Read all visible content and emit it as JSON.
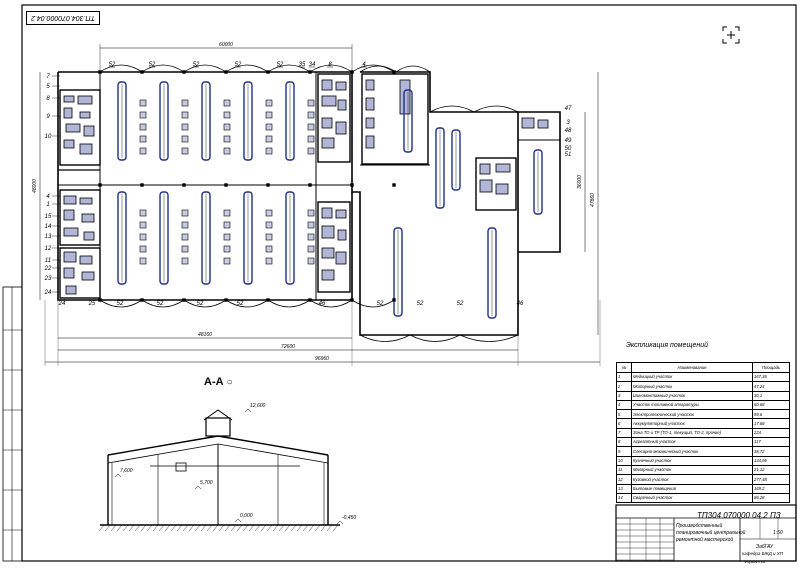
{
  "doc_code_top": "ТП.304.070000.04.2",
  "doc_code_title": "ТП304 070000 04.2 ПЗ",
  "section": {
    "name": "А-А"
  },
  "explikation_title": "Экспликация помещений",
  "table": {
    "headers": [
      "№",
      "Наименование",
      "Площадь"
    ],
    "rows": [
      [
        "1",
        "Медницкий участок",
        "167,36"
      ],
      [
        "2",
        "Моторный участок",
        "47,24"
      ],
      [
        "3",
        "Шиномонтажный участок",
        "30,1"
      ],
      [
        "4",
        "Участок топливной аппаратуры",
        "60,68"
      ],
      [
        "5",
        "Электротехнический участок",
        "99,6"
      ],
      [
        "6",
        "Аккумуляторный участок",
        "17,68"
      ],
      [
        "7",
        "Зона ТО и ТР (ТО-1, текущий, ТО-2, прочие)",
        "224"
      ],
      [
        "8",
        "Агрегатный участок",
        "117"
      ],
      [
        "9",
        "Слесарно-механический участок",
        "38,72"
      ],
      [
        "10",
        "Кузнечный участок",
        "144,96"
      ],
      [
        "11",
        "Малярный участок",
        "21,12"
      ],
      [
        "12",
        "Кузовной участок",
        "277,48"
      ],
      [
        "13",
        "Бытовые помещения",
        "169,2"
      ],
      [
        "14",
        "Сварочный участок",
        "86,28"
      ]
    ]
  },
  "title_block": {
    "description_line1": "Производственный",
    "description_line2": "планировочный центральной",
    "description_line3": "ремонтной мастерской",
    "scale": "1:50",
    "department_line1": "ЗабГАУ",
    "department_line2": "кафедра БЖД и ХП",
    "sheet_label": "Формат А1"
  },
  "dims": {
    "top_overall": "60000",
    "bottom_1": "48160",
    "bottom_2": "72600",
    "bottom_3": "96960",
    "left_height": "48000",
    "right_height_1": "36000",
    "right_height_2": "47860",
    "sec_top": "12,600",
    "sec_left": "7,600",
    "sec_mid": "5,700",
    "sec_ground": "0,000",
    "sec_right": "-0,450"
  },
  "plan_top_labels": [
    "52",
    "52",
    "52",
    "52",
    "52",
    "35",
    "34",
    "8",
    "4"
  ],
  "plan_bottom_labels": [
    "24",
    "25",
    "52",
    "52",
    "52",
    "52",
    "46",
    "52",
    "52",
    "52",
    "46"
  ],
  "plan_left_labels": [
    "7",
    "5",
    "8",
    "9",
    "10",
    "4",
    "1",
    "15",
    "14",
    "13",
    "12",
    "11",
    "22",
    "23",
    "24"
  ],
  "plan_right_labels": [
    "47",
    "3",
    "48",
    "49",
    "50",
    "51"
  ]
}
